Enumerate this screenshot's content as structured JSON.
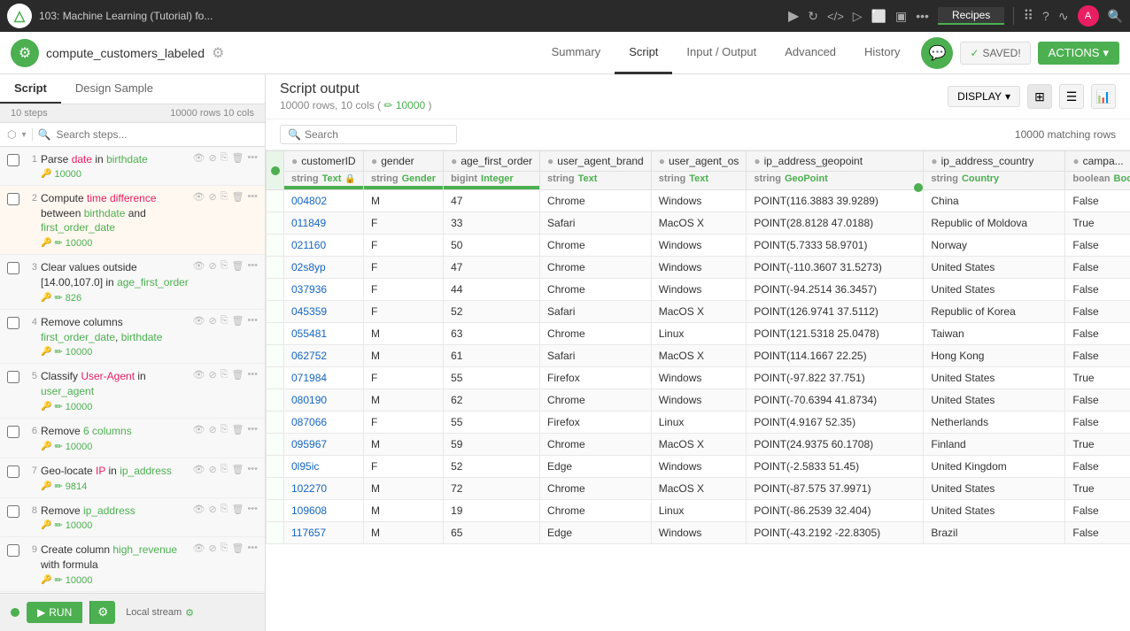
{
  "topbar": {
    "title": "103: Machine Learning (Tutorial) fo...",
    "recipes_label": "Recipes"
  },
  "secondbar": {
    "dataset_name": "compute_customers_labeled",
    "tabs": [
      "Summary",
      "Script",
      "Input / Output",
      "Advanced",
      "History"
    ],
    "active_tab": "Script",
    "saved_label": "SAVED!",
    "actions_label": "ACTIONS"
  },
  "sidebar": {
    "tab1": "Script",
    "tab2": "Design Sample",
    "steps_count": "10 steps",
    "rows_count": "10000 rows 10 cols",
    "search_placeholder": "Search steps...",
    "steps": [
      {
        "id": 1,
        "text": "Parse date in birthdate",
        "highlight": "",
        "count": "10000"
      },
      {
        "id": 2,
        "text": "Compute time difference between birthdate and first_order_date",
        "highlight": "",
        "count": "10000"
      },
      {
        "id": 3,
        "text": "Clear values outside [14.00,107.0] in age_first_order",
        "highlight": "",
        "count": "826"
      },
      {
        "id": 4,
        "text": "Remove columns first_order_date, birthdate",
        "highlight": "",
        "count": "10000"
      },
      {
        "id": 5,
        "text": "Classify User-Agent in user_agent",
        "highlight": "",
        "count": "10000"
      },
      {
        "id": 6,
        "text": "Remove 6 columns",
        "highlight": "",
        "count": "10000"
      },
      {
        "id": 7,
        "text": "Geo-locate IP in ip_address",
        "highlight": "",
        "count": "9814"
      },
      {
        "id": 8,
        "text": "Remove ip_address",
        "highlight": "",
        "count": "10000"
      },
      {
        "id": 9,
        "text": "Create column high_revenue with formula",
        "highlight": "",
        "count": "10000"
      }
    ],
    "run_label": "RUN",
    "local_stream": "Local stream"
  },
  "content": {
    "title": "Script output",
    "rows": "10000 rows,",
    "cols": "10 cols",
    "link_count": "10000",
    "matching_rows": "10000 matching rows",
    "display_label": "DISPLAY",
    "search_placeholder": "Search"
  },
  "table": {
    "columns": [
      {
        "name": "customerID",
        "type": "string",
        "tag": "Text",
        "lock": true,
        "bar": true
      },
      {
        "name": "gender",
        "type": "string",
        "tag": "Gender",
        "lock": false,
        "bar": true
      },
      {
        "name": "age_first_order",
        "type": "bigint",
        "tag": "Integer",
        "lock": false,
        "bar": true
      },
      {
        "name": "user_agent_brand",
        "type": "string",
        "tag": "Text",
        "lock": false,
        "bar": false
      },
      {
        "name": "user_agent_os",
        "type": "string",
        "tag": "Text",
        "lock": false,
        "bar": false
      },
      {
        "name": "ip_address_geopoint",
        "type": "string",
        "tag": "GeoPoint",
        "lock": false,
        "bar": false
      },
      {
        "name": "ip_address_country",
        "type": "string",
        "tag": "Country",
        "lock": false,
        "bar": false
      },
      {
        "name": "campa...",
        "type": "boolean",
        "tag": "Boolean",
        "lock": false,
        "bar": false
      }
    ],
    "rows": [
      [
        "004802",
        "M",
        "47",
        "Chrome",
        "Windows",
        "POINT(116.3883 39.9289)",
        "China",
        "False"
      ],
      [
        "011849",
        "F",
        "33",
        "Safari",
        "MacOS X",
        "POINT(28.8128 47.0188)",
        "Republic of Moldova",
        "True"
      ],
      [
        "021160",
        "F",
        "50",
        "Chrome",
        "Windows",
        "POINT(5.7333 58.9701)",
        "Norway",
        "False"
      ],
      [
        "02s8yp",
        "F",
        "47",
        "Chrome",
        "Windows",
        "POINT(-110.3607 31.5273)",
        "United States",
        "False"
      ],
      [
        "037936",
        "F",
        "44",
        "Chrome",
        "Windows",
        "POINT(-94.2514 36.3457)",
        "United States",
        "False"
      ],
      [
        "045359",
        "F",
        "52",
        "Safari",
        "MacOS X",
        "POINT(126.9741 37.5112)",
        "Republic of Korea",
        "False"
      ],
      [
        "055481",
        "M",
        "63",
        "Chrome",
        "Linux",
        "POINT(121.5318 25.0478)",
        "Taiwan",
        "False"
      ],
      [
        "062752",
        "M",
        "61",
        "Safari",
        "MacOS X",
        "POINT(114.1667 22.25)",
        "Hong Kong",
        "False"
      ],
      [
        "071984",
        "F",
        "55",
        "Firefox",
        "Windows",
        "POINT(-97.822 37.751)",
        "United States",
        "True"
      ],
      [
        "080190",
        "M",
        "62",
        "Chrome",
        "Windows",
        "POINT(-70.6394 41.8734)",
        "United States",
        "False"
      ],
      [
        "087066",
        "F",
        "55",
        "Firefox",
        "Linux",
        "POINT(4.9167 52.35)",
        "Netherlands",
        "False"
      ],
      [
        "095967",
        "M",
        "59",
        "Chrome",
        "MacOS X",
        "POINT(24.9375 60.1708)",
        "Finland",
        "True"
      ],
      [
        "0l95ic",
        "F",
        "52",
        "Edge",
        "Windows",
        "POINT(-2.5833 51.45)",
        "United Kingdom",
        "False"
      ],
      [
        "102270",
        "M",
        "72",
        "Chrome",
        "MacOS X",
        "POINT(-87.575 37.9971)",
        "United States",
        "True"
      ],
      [
        "109608",
        "M",
        "19",
        "Chrome",
        "Linux",
        "POINT(-86.2539 32.404)",
        "United States",
        "False"
      ],
      [
        "117657",
        "M",
        "65",
        "Edge",
        "Windows",
        "POINT(-43.2192 -22.8305)",
        "Brazil",
        "False"
      ]
    ]
  }
}
